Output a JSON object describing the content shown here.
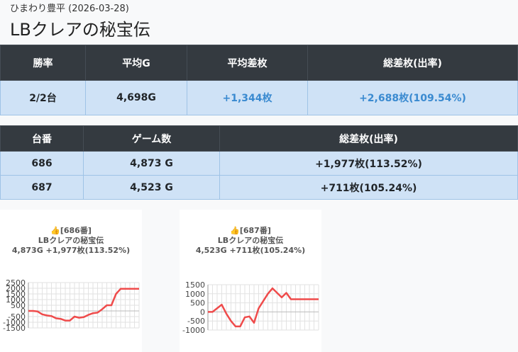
{
  "header": {
    "store": "ひまわり豊平 (2026-03-28)",
    "title": "LBクレアの秘宝伝"
  },
  "summary": {
    "headers": [
      "勝率",
      "平均G",
      "平均差枚",
      "総差枚(出率)"
    ],
    "row": [
      "2/2台",
      "4,698G",
      "+1,344枚",
      "+2,688枚(109.54%)"
    ]
  },
  "machines": {
    "headers": [
      "台番",
      "ゲーム数",
      "総差枚(出率)"
    ],
    "rows": [
      [
        "686",
        "4,873 G",
        "+1,977枚(113.52%)"
      ],
      [
        "687",
        "4,523 G",
        "+711枚(105.24%)"
      ]
    ]
  },
  "charts": [
    {
      "caption": [
        "👍[686番]",
        "LBクレアの秘宝伝",
        "4,873G +1,977枚(113.52%)"
      ],
      "y_ticks": [
        "2500",
        "2000",
        "1500",
        "1000",
        "500",
        "0",
        "-500",
        "-1000",
        "-1500"
      ],
      "line_color": "#ef4b4b"
    },
    {
      "caption": [
        "👍[687番]",
        "LBクレアの秘宝伝",
        "4,523G +711枚(105.24%)"
      ],
      "y_ticks": [
        "1500",
        "1000",
        "500",
        "0",
        "-500",
        "-1000"
      ],
      "line_color": "#ef4b4b"
    }
  ],
  "chart_data": [
    {
      "type": "line",
      "title": "686",
      "ylim": [
        -1500,
        2500
      ],
      "x": [
        0,
        1,
        2,
        3,
        4,
        5,
        6,
        7,
        8,
        9,
        10,
        11,
        12,
        13,
        14,
        15,
        16,
        17,
        18,
        19,
        20,
        21,
        22,
        23,
        24
      ],
      "series": [
        {
          "name": "",
          "values": [
            0,
            0,
            -50,
            -300,
            -400,
            -450,
            -650,
            -700,
            -850,
            -850,
            -500,
            -600,
            -550,
            -350,
            -200,
            -150,
            150,
            500,
            500,
            1500,
            1950,
            1950,
            1950,
            1950,
            1950
          ]
        }
      ]
    },
    {
      "type": "line",
      "title": "687",
      "ylim": [
        -1000,
        1500
      ],
      "x": [
        0,
        1,
        2,
        3,
        4,
        5,
        6,
        7,
        8,
        9,
        10,
        11,
        12,
        13,
        14,
        15,
        16,
        17,
        18,
        19,
        20,
        21,
        22,
        23,
        24
      ],
      "series": [
        {
          "name": "",
          "values": [
            0,
            0,
            200,
            400,
            -100,
            -500,
            -800,
            -800,
            -300,
            -250,
            -600,
            200,
            600,
            1000,
            1300,
            1050,
            800,
            1050,
            700,
            700,
            700,
            700,
            700,
            700,
            700
          ]
        }
      ]
    }
  ]
}
